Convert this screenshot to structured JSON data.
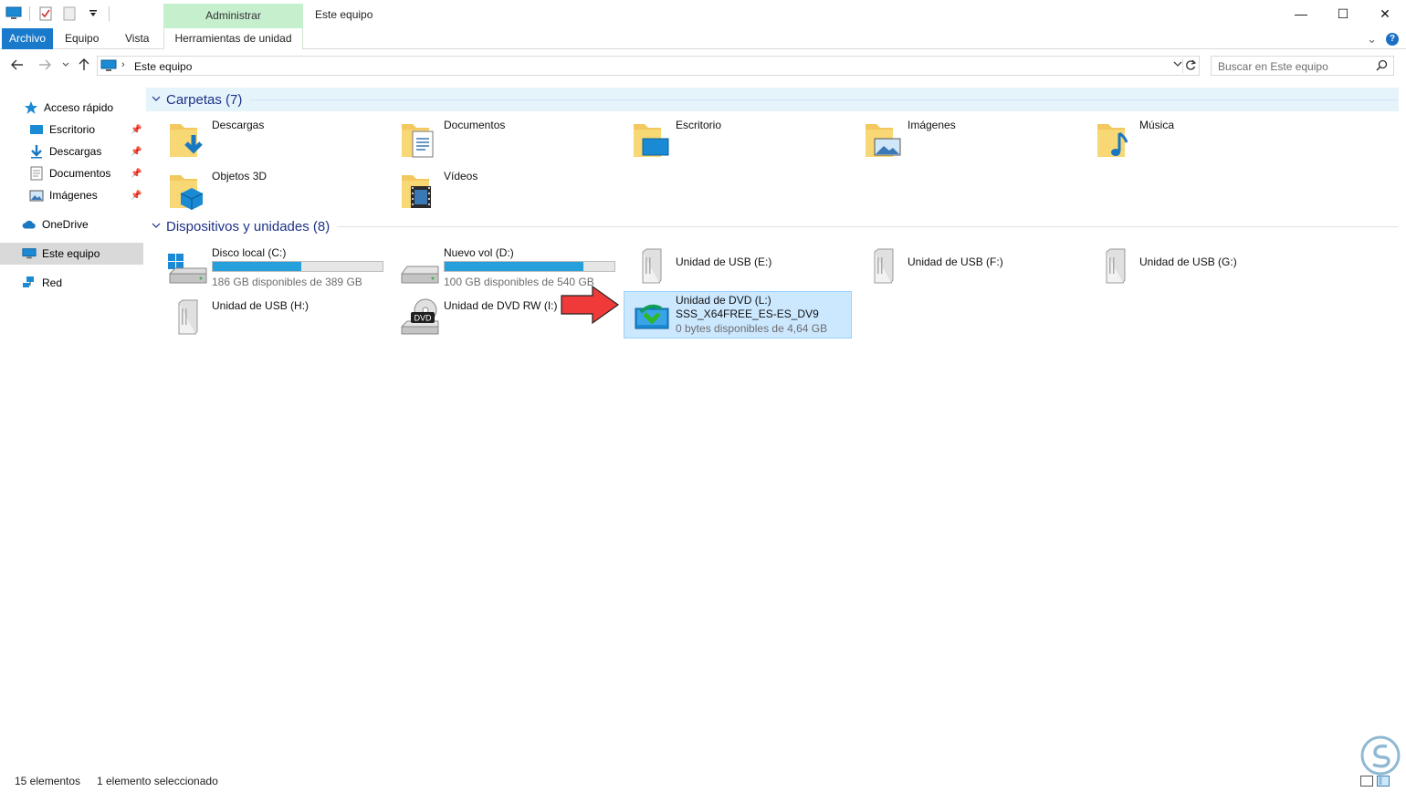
{
  "window": {
    "title": "Este equipo",
    "contextual_tab": "Administrar",
    "controls": {
      "minimize": "—",
      "maximize": "☐",
      "close": "✕"
    }
  },
  "ribbon": {
    "tabs": [
      "Archivo",
      "Equipo",
      "Vista",
      "Herramientas de unidad"
    ],
    "collapse_glyph": "⌄",
    "help_glyph": "?"
  },
  "address": {
    "path": "Este equipo",
    "separator": "›",
    "search_placeholder": "Buscar en Este equipo"
  },
  "nav": {
    "quick_access": "Acceso rápido",
    "pinned": [
      "Escritorio",
      "Descargas",
      "Documentos",
      "Imágenes"
    ],
    "onedrive": "OneDrive",
    "this_pc": "Este equipo",
    "network": "Red"
  },
  "groups": {
    "folders_title": "Carpetas (7)",
    "devices_title": "Dispositivos y unidades (8)"
  },
  "folders": [
    "Descargas",
    "Documentos",
    "Escritorio",
    "Imágenes",
    "Música",
    "Objetos 3D",
    "Vídeos"
  ],
  "drives": [
    {
      "name": "Disco local (C:)",
      "free": "186 GB disponibles de 389 GB",
      "used_fraction": 0.52
    },
    {
      "name": "Nuevo vol (D:)",
      "free": "100 GB disponibles de 540 GB",
      "used_fraction": 0.815
    },
    {
      "name": "Unidad de USB (E:)"
    },
    {
      "name": "Unidad de USB (F:)"
    },
    {
      "name": "Unidad de USB (G:)"
    },
    {
      "name": "Unidad de USB (H:)"
    },
    {
      "name": "Unidad de DVD RW (I:)",
      "badge": "DVD"
    },
    {
      "name": "Unidad de DVD (L:)",
      "label": "SSS_X64FREE_ES-ES_DV9",
      "free": "0 bytes disponibles de 4,64 GB"
    }
  ],
  "status": {
    "count": "15 elementos",
    "selection": "1 elemento seleccionado"
  },
  "colors": {
    "accent": "#1979ca",
    "selection": "#cce8ff",
    "selection_border": "#99d1ff",
    "bar_fill": "#26a0da",
    "group_title": "#1e3287",
    "contextual": "#c6efce",
    "arrow": "#f03a3a"
  }
}
